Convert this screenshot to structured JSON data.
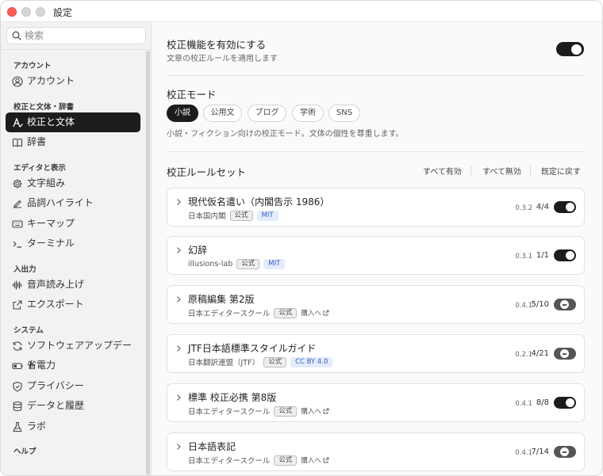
{
  "window": {
    "title": "設定"
  },
  "sidebar": {
    "search_placeholder": "検索",
    "groups": [
      {
        "title": "アカウント",
        "items": [
          {
            "label": "アカウント",
            "icon": "account-icon"
          }
        ]
      },
      {
        "title": "校正と文体・辞書",
        "items": [
          {
            "label": "校正と文体",
            "icon": "proofread-icon",
            "active": true
          },
          {
            "label": "辞書",
            "icon": "book-icon"
          }
        ]
      },
      {
        "title": "エディタと表示",
        "items": [
          {
            "label": "文字組み",
            "icon": "gear-icon"
          },
          {
            "label": "品詞ハイライト",
            "icon": "highlight-icon"
          },
          {
            "label": "キーマップ",
            "icon": "keyboard-icon"
          },
          {
            "label": "ターミナル",
            "icon": "terminal-icon"
          }
        ]
      },
      {
        "title": "入出力",
        "items": [
          {
            "label": "音声読み上げ",
            "icon": "waveform-icon"
          },
          {
            "label": "エクスポート",
            "icon": "export-icon"
          }
        ]
      },
      {
        "title": "システム",
        "items": [
          {
            "label": "ソフトウェアアップデート",
            "icon": "refresh-icon"
          },
          {
            "label": "省電力",
            "icon": "battery-icon"
          },
          {
            "label": "プライバシー",
            "icon": "shield-icon"
          },
          {
            "label": "データと履歴",
            "icon": "database-icon"
          },
          {
            "label": "ラボ",
            "icon": "flask-icon"
          }
        ]
      },
      {
        "title": "ヘルプ",
        "items": []
      }
    ]
  },
  "main": {
    "enable": {
      "title": "校正機能を有効にする",
      "subtitle": "文章の校正ルールを適用します",
      "on": true
    },
    "mode": {
      "title": "校正モード",
      "options": [
        "小説",
        "公用文",
        "ブログ",
        "学術",
        "SNS"
      ],
      "selected": "小説",
      "description": "小説・フィクション向けの校正モード。文体の個性を尊重します。"
    },
    "rulesets": {
      "title": "校正ルールセット",
      "actions": [
        "すべて有効",
        "すべて無効",
        "既定に戻す"
      ],
      "items": [
        {
          "name": "現代仮名遣い（内閣告示 1986）",
          "author": "日本国内閣",
          "official": "公式",
          "license": "MIT",
          "buy": "",
          "version": "0.3.2",
          "count": "4/4",
          "state": "on"
        },
        {
          "name": "幻辞",
          "author": "illusions-lab",
          "official": "公式",
          "license": "MIT",
          "buy": "",
          "version": "0.3.1",
          "count": "1/1",
          "state": "on"
        },
        {
          "name": "原稿編集 第2版",
          "author": "日本エディタースクール",
          "official": "公式",
          "license": "",
          "buy": "購入へ",
          "version": "0.4.1",
          "count": "5/10",
          "state": "partial"
        },
        {
          "name": "JTF日本語標準スタイルガイド",
          "author": "日本翻訳連盟（JTF）",
          "official": "公式",
          "license": "CC BY 4.0",
          "buy": "",
          "version": "0.2.1",
          "count": "4/21",
          "state": "partial"
        },
        {
          "name": "標準 校正必携 第8版",
          "author": "日本エディタースクール",
          "official": "公式",
          "license": "",
          "buy": "購入へ",
          "version": "0.4.1",
          "count": "8/8",
          "state": "on"
        },
        {
          "name": "日本語表記",
          "author": "日本エディタースクール",
          "official": "公式",
          "license": "",
          "buy": "購入へ",
          "version": "0.4.1",
          "count": "7/14",
          "state": "partial"
        }
      ]
    }
  }
}
